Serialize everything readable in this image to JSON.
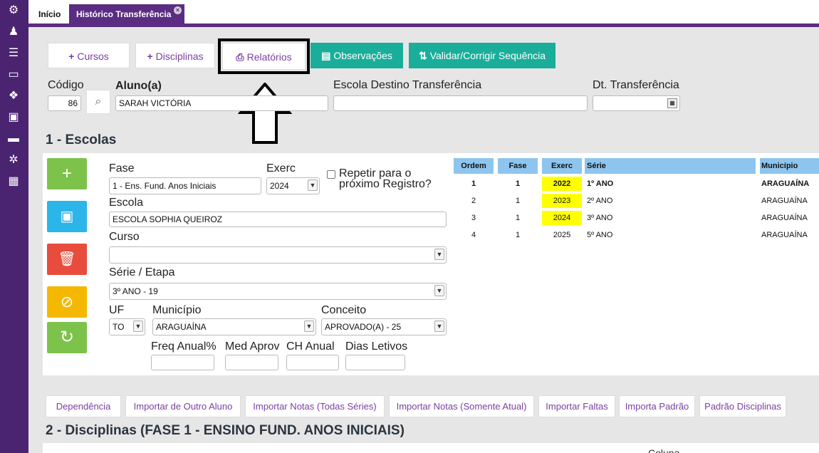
{
  "tabs": {
    "inicio": "Início",
    "historico": "Histórico Transferência",
    "close": "×"
  },
  "toolbar": {
    "cursos": "Cursos",
    "disciplinas": "Disciplinas",
    "relatorios": "Relatórios",
    "observacoes": "Observações",
    "validar": "Validar/Corrigir Sequência"
  },
  "aluno_form": {
    "codigo_label": "Código",
    "codigo_value": "86",
    "aluno_label": "Aluno(a)",
    "aluno_value": "SARAH VICTÓRIA",
    "escola_destino_label": "Escola Destino Transferência",
    "escola_destino_value": "",
    "dt_label": "Dt. Transferência",
    "dt_value": ""
  },
  "section1": {
    "title": "1 - Escolas"
  },
  "escola_form": {
    "fase_label": "Fase",
    "fase_value": "1 - Ens. Fund. Anos Iniciais",
    "exerc_label": "Exerc",
    "exerc_value": "2024",
    "repetir_label_1": "Repetir para o",
    "repetir_label_2": "próximo Registro?",
    "escola_label": "Escola",
    "escola_value": "ESCOLA SOPHIA QUEIROZ",
    "curso_label": "Curso",
    "curso_value": "",
    "serie_label": "Série / Etapa",
    "serie_value": "3º ANO - 19",
    "uf_label": "UF",
    "uf_value": "TO",
    "municipio_label": "Município",
    "municipio_value": "ARAGUAÍNA",
    "conceito_label": "Conceito",
    "conceito_value": "APROVADO(A) - 25",
    "freq_label": "Freq Anual%",
    "med_label": "Med Aprov",
    "ch_label": "CH Anual",
    "dias_label": "Dias Letivos"
  },
  "table": {
    "headers": [
      "Ordem",
      "Fase",
      "Exerc",
      "Série",
      "Município"
    ],
    "rows": [
      {
        "ordem": "1",
        "fase": "1",
        "exerc": "2022",
        "serie": "1º ANO",
        "municipio": "ARAGUAÍNA"
      },
      {
        "ordem": "2",
        "fase": "1",
        "exerc": "2023",
        "serie": "2º ANO",
        "municipio": "ARAGUAÍNA"
      },
      {
        "ordem": "3",
        "fase": "1",
        "exerc": "2024",
        "serie": "3º ANO",
        "municipio": "ARAGUAÍNA"
      },
      {
        "ordem": "4",
        "fase": "1",
        "exerc": "2025",
        "serie": "5º ANO",
        "municipio": "ARAGUAÍNA"
      }
    ]
  },
  "bottom_buttons": [
    "Dependência",
    "Importar de Outro Aluno",
    "Importar Notas (Todas Séries)",
    "Importar Notas (Somente Atual)",
    "Importar Faltas",
    "Importa Padrão",
    "Padrão Disciplinas"
  ],
  "section2": {
    "title": "2 - Disciplinas (FASE 1 - ENSINO FUND. ANOS INICIAIS)",
    "partial": "Coluna"
  },
  "colors": {
    "sidebar": "#4a2470",
    "accent": "#5a2d82",
    "teal": "#1aae9a",
    "green": "#7dc24b",
    "blue": "#2bb5e8",
    "red": "#e74c3c",
    "yellow": "#f5b800",
    "header_blue": "#8ec5ee",
    "highlight": "#ffff00"
  }
}
